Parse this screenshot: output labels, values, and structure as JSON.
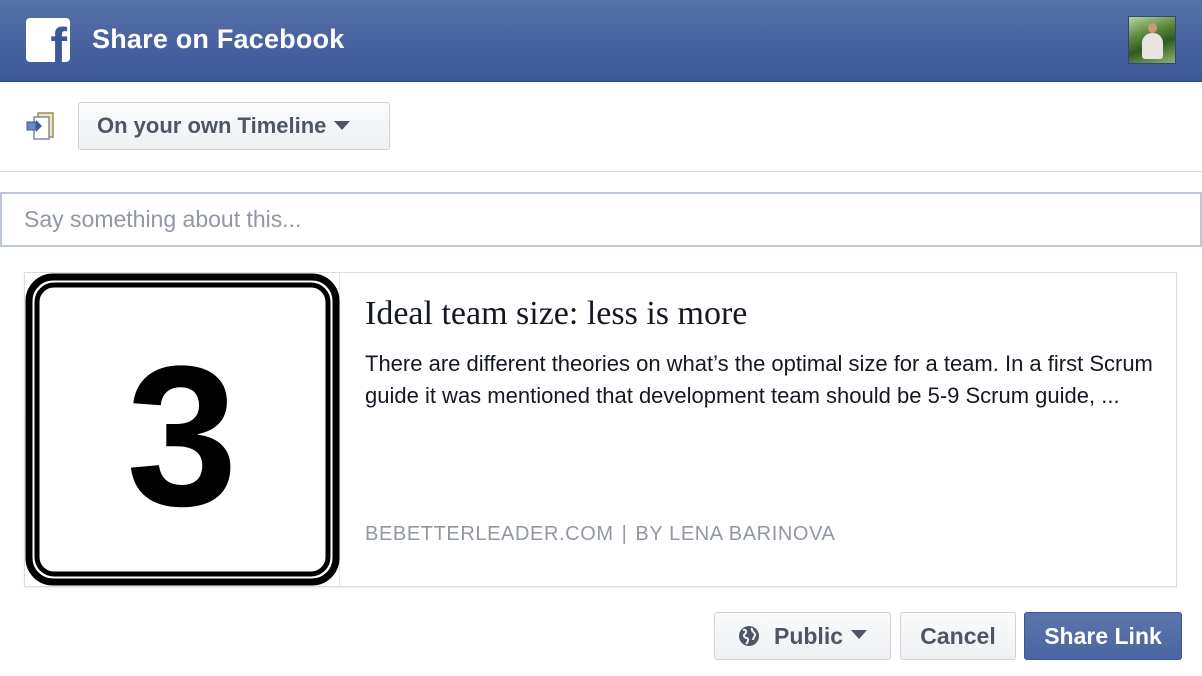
{
  "header": {
    "title": "Share on Facebook",
    "logo_letter": "f",
    "brand_color": "#3b5998"
  },
  "audience": {
    "icon": "timeline-share-icon",
    "selected": "On your own Timeline"
  },
  "composer": {
    "placeholder": "Say something about this..."
  },
  "preview": {
    "thumbnail_icon": "number-3-sign-icon",
    "thumbnail_text": "3",
    "title": "Ideal team size: less is more",
    "description": "There are different theories on what’s the optimal size for a team. In a first Scrum guide it was mentioned that development team should be 5-9 Scrum guide, ...",
    "domain": "BEBETTERLEADER.COM",
    "separator": "|",
    "author": "BY LENA BARINOVA"
  },
  "actions": {
    "privacy_label": "Public",
    "privacy_icon": "globe-icon",
    "cancel_label": "Cancel",
    "share_label": "Share Link"
  }
}
